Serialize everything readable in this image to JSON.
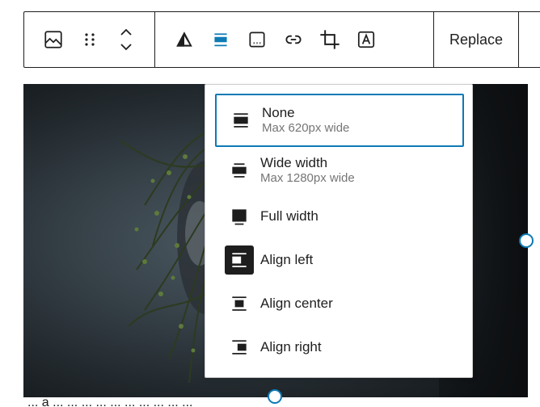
{
  "toolbar": {
    "buttons": [
      {
        "icon": "image-icon"
      },
      {
        "icon": "drag-handle-icon"
      },
      {
        "icon": "move-up-down-icon"
      },
      {
        "icon": "duotone-filter-icon"
      },
      {
        "icon": "align-icon",
        "active": true
      },
      {
        "icon": "caption-icon"
      },
      {
        "icon": "link-icon"
      },
      {
        "icon": "crop-icon"
      },
      {
        "icon": "text-overlay-icon"
      }
    ],
    "replace_label": "Replace"
  },
  "align_menu": {
    "items": [
      {
        "label": "None",
        "sub": "Max 620px wide",
        "icon": "align-none-icon",
        "selected": true
      },
      {
        "label": "Wide width",
        "sub": "Max 1280px wide",
        "icon": "align-wide-icon"
      },
      {
        "label": "Full width",
        "sub": "",
        "icon": "align-full-icon"
      },
      {
        "label": "Align left",
        "sub": "",
        "icon": "align-left-icon",
        "highlighted": true
      },
      {
        "label": "Align center",
        "sub": "",
        "icon": "align-center-icon"
      },
      {
        "label": "Align right",
        "sub": "",
        "icon": "align-right-icon"
      }
    ]
  },
  "caption_fragment": "  ...  a  ...  ...  ...  ...  ...  ...  ...  ...  ...  ...",
  "colors": {
    "accent": "#0d7ab5",
    "active": "#3858e9",
    "text": "#1e1e1e",
    "muted": "#757575"
  }
}
